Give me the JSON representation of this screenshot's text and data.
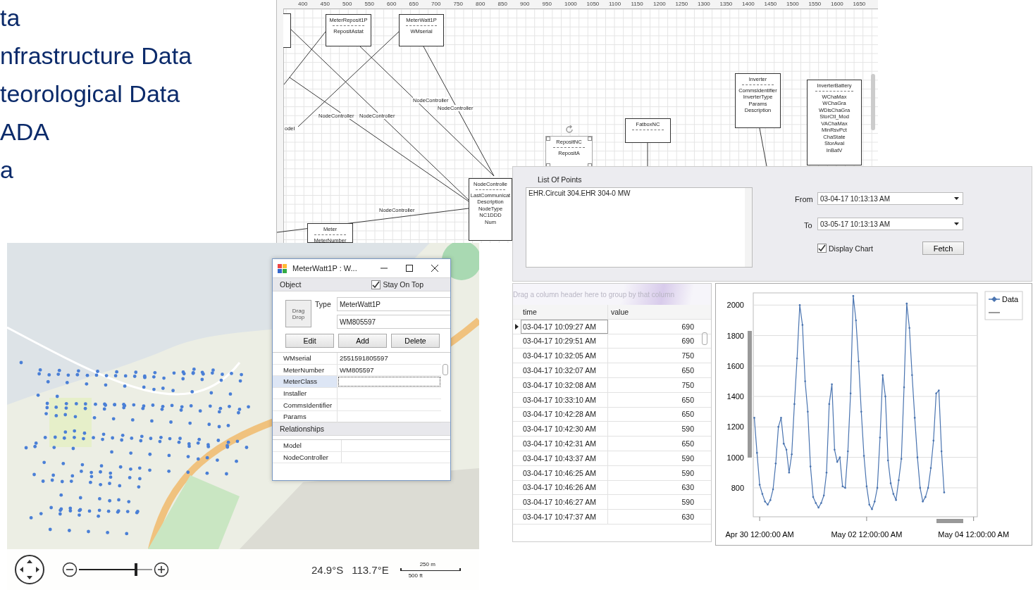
{
  "slide_text": {
    "lines": [
      "ta",
      "nfrastructure Data",
      "teorological Data",
      "ADA",
      "a"
    ]
  },
  "diagram": {
    "ruler_labels": [
      "400",
      "450",
      "500",
      "550",
      "600",
      "650",
      "700",
      "750",
      "800",
      "850",
      "900",
      "950",
      "1000",
      "1050",
      "1100",
      "1150",
      "1200",
      "1250",
      "1300",
      "1350",
      "1400",
      "1450",
      "1500",
      "1550",
      "1600",
      "1650"
    ],
    "nodes": [
      {
        "title": "MeterReposit1P",
        "fields": [
          "RepositAstat"
        ],
        "selected": false
      },
      {
        "title": "MeterWatt1P",
        "fields": [
          "WMserial"
        ],
        "selected": false
      },
      {
        "title": "Inverter",
        "fields": [
          "CommsIdentifier",
          "InverterType",
          "Params",
          "Description"
        ],
        "selected": false
      },
      {
        "title": "InverterBattery",
        "fields": [
          "WChaMax",
          "WChaGra",
          "WDisChaGra",
          "StorCtl_Mod",
          "VAChaMax",
          "MinRsvPct",
          "ChaState",
          "StorAval",
          "InBatV"
        ],
        "selected": false
      },
      {
        "title": "FatboxNC",
        "selected": false
      },
      {
        "title": "RepositNC",
        "fields": [
          "RepositA"
        ],
        "selected": true
      },
      {
        "title": "NodeControlle",
        "fields": [
          "LastCommunicat",
          "Description",
          "NodeType",
          "NC1DDD",
          "Num"
        ],
        "selected": false
      },
      {
        "title": "Meter",
        "fields": [
          "MeterNumber"
        ],
        "selected": false
      }
    ],
    "edge_labels": [
      "NodeController",
      "NodeController",
      "NodeController",
      "NodeController",
      "NodeController"
    ],
    "side_label": "odel"
  },
  "query": {
    "list_label": "List Of Points",
    "points": [
      "EHR.Circuit 304.EHR 304-0 MW"
    ],
    "from": {
      "label": "From",
      "value": "03-04-17 10:13:13 AM"
    },
    "to": {
      "label": "To",
      "value": "03-05-17 10:13:13 AM"
    },
    "display_chart": {
      "label": "Display Chart",
      "checked": true
    },
    "fetch_button": "Fetch"
  },
  "grid": {
    "group_hint": "Drag a column header here to group by that column",
    "columns": [
      "time",
      "value"
    ],
    "rows": [
      {
        "time": "03-04-17 10:09:27 AM",
        "value": "690",
        "current": true
      },
      {
        "time": "03-04-17 10:29:51 AM",
        "value": "690",
        "current": false
      },
      {
        "time": "03-04-17 10:32:05 AM",
        "value": "750",
        "current": false
      },
      {
        "time": "03-04-17 10:32:07 AM",
        "value": "650",
        "current": false
      },
      {
        "time": "03-04-17 10:32:08 AM",
        "value": "750",
        "current": false
      },
      {
        "time": "03-04-17 10:33:10 AM",
        "value": "650",
        "current": false
      },
      {
        "time": "03-04-17 10:42:28 AM",
        "value": "650",
        "current": false
      },
      {
        "time": "03-04-17 10:42:30 AM",
        "value": "590",
        "current": false
      },
      {
        "time": "03-04-17 10:42:31 AM",
        "value": "650",
        "current": false
      },
      {
        "time": "03-04-17 10:43:37 AM",
        "value": "590",
        "current": false
      },
      {
        "time": "03-04-17 10:46:25 AM",
        "value": "590",
        "current": false
      },
      {
        "time": "03-04-17 10:46:26 AM",
        "value": "630",
        "current": false
      },
      {
        "time": "03-04-17 10:46:27 AM",
        "value": "590",
        "current": false
      },
      {
        "time": "03-04-17 10:47:37 AM",
        "value": "630",
        "current": false
      }
    ]
  },
  "chart": {
    "chart_data": {
      "type": "line",
      "ylim": [
        610,
        2080
      ],
      "yticks": [
        800,
        1000,
        1200,
        1400,
        1600,
        1800,
        2000
      ],
      "categories": [
        null,
        null,
        "Apr 30 12:00:00 AM",
        null,
        null,
        null,
        null,
        null,
        null,
        null,
        null,
        null,
        null,
        null,
        null,
        null,
        null,
        null,
        null,
        null,
        null,
        null,
        null,
        null,
        null,
        null,
        null,
        null,
        null,
        null,
        null,
        null,
        null,
        null,
        null,
        null,
        null,
        null,
        null,
        null,
        null,
        null,
        "May 02 12:00:00 AM",
        null,
        null,
        null,
        null,
        null,
        null,
        null,
        null,
        null,
        null,
        null,
        null,
        null,
        null,
        null,
        null,
        null,
        null,
        null,
        null,
        null,
        null,
        null,
        null,
        null,
        null,
        null,
        null,
        null,
        null,
        null,
        null,
        null,
        null,
        null,
        null,
        null,
        null,
        null,
        "May 04 12:00:00 AM",
        null
      ],
      "series": [
        {
          "name": "Data",
          "color": "#4a74b0",
          "values": [
            1260,
            1030,
            820,
            760,
            710,
            690,
            720,
            790,
            960,
            1200,
            1260,
            1090,
            1050,
            900,
            1020,
            1350,
            1650,
            2000,
            1870,
            1500,
            1300,
            940,
            740,
            700,
            670,
            700,
            750,
            900,
            1350,
            1480,
            1050,
            970,
            1000,
            810,
            800,
            1040,
            1420,
            2060,
            1900,
            1630,
            1300,
            1010,
            810,
            690,
            660,
            710,
            800,
            1130,
            1540,
            1400,
            980,
            830,
            760,
            720,
            850,
            990,
            1460,
            2010,
            1850,
            1540,
            1260,
            1000,
            800,
            710,
            740,
            800,
            930,
            1110,
            1420,
            1440,
            1040,
            770,
            null,
            null,
            null,
            null,
            null,
            null,
            null,
            null,
            null,
            null,
            null,
            null
          ]
        }
      ],
      "grid": true
    }
  },
  "dialog": {
    "title": "MeterWatt1P : W...",
    "section_label": "Object",
    "stay_on_top": {
      "label": "Stay On Top",
      "checked": true
    },
    "drag_button": "Drag Drop",
    "type_label": "Type",
    "type_value": "MeterWatt1P",
    "name_value": "WM805597",
    "buttons": [
      "Edit",
      "Add",
      "Delete"
    ],
    "properties": [
      {
        "name": "WMserial",
        "value": "2551591805597",
        "selected": false
      },
      {
        "name": "MeterNumber",
        "value": "WM805597",
        "selected": false
      },
      {
        "name": "MeterClass",
        "selected": true
      },
      {
        "name": "Installer",
        "selected": false
      },
      {
        "name": "CommsIdentifier",
        "selected": false
      },
      {
        "name": "Params",
        "selected": false
      }
    ],
    "relationships_label": "Relationships",
    "relationships": [
      "Model",
      "NodeController"
    ]
  },
  "map": {
    "latitude": "24.9°S",
    "longitude": "113.7°E",
    "scale_metric": "250 m",
    "scale_imperial": "500 ft",
    "zoom": {
      "level": 0.8
    }
  }
}
